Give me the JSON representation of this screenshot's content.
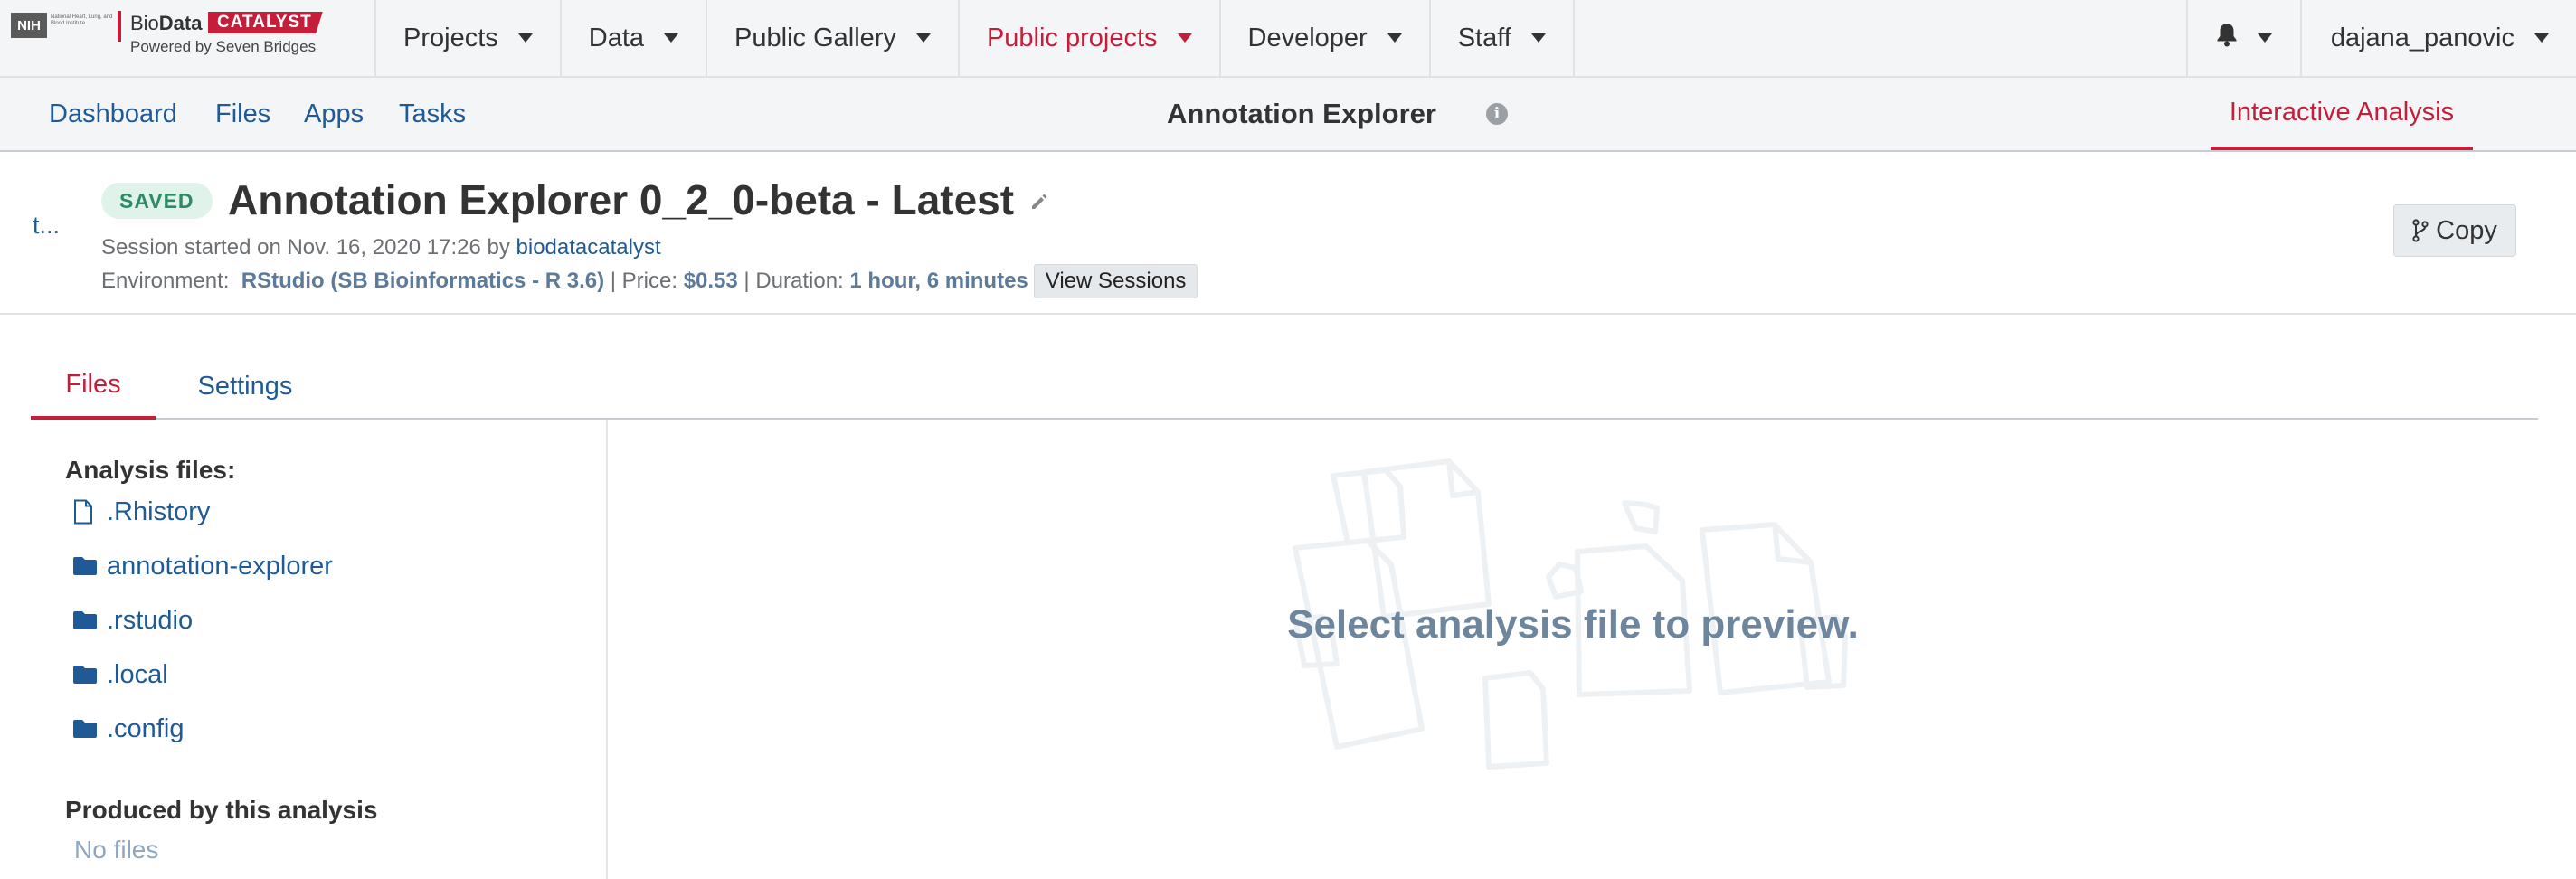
{
  "brand": {
    "nih": "NIH",
    "nih_text": "National Heart, Lung, and Blood Institute",
    "bio_prefix": "Bio",
    "bio_bold": "Data",
    "catalyst": "CATALYST",
    "powered": "Powered by Seven Bridges",
    "accent": "#c41e3a"
  },
  "topnav": {
    "items": [
      {
        "label": "Projects"
      },
      {
        "label": "Data"
      },
      {
        "label": "Public Gallery"
      },
      {
        "label": "Public projects"
      },
      {
        "label": "Developer"
      },
      {
        "label": "Staff"
      }
    ],
    "user": "dajana_panovic",
    "bell_icon": "bell-icon"
  },
  "subnav": {
    "links": [
      "Dashboard",
      "Files",
      "Apps",
      "Tasks"
    ],
    "title": "Annotation Explorer",
    "info_icon": "i",
    "active_tab": "Interactive Analysis"
  },
  "session": {
    "back": "t...",
    "status": "SAVED",
    "title": "Annotation Explorer 0_2_0-beta - Latest",
    "started_prefix": "Session started on Nov. 16, 2020 17:26 by ",
    "started_by": "biodatacatalyst",
    "env_label": "Environment:  ",
    "env_value": "RStudio (SB Bioinformatics - R 3.6)",
    "sep1": " | ",
    "price_label": "Price: ",
    "price_value": "$0.53",
    "sep2": " | ",
    "duration_label": "Duration: ",
    "duration_value": "1 hour, 6 minutes",
    "view_sessions": "View Sessions",
    "copy": "Copy"
  },
  "tabs": {
    "files": "Files",
    "settings": "Settings"
  },
  "files_panel": {
    "analysis_heading": "Analysis files:",
    "items": [
      {
        "name": ".Rhistory",
        "icon": "file-icon"
      },
      {
        "name": "annotation-explorer",
        "icon": "folder-icon"
      },
      {
        "name": ".rstudio",
        "icon": "folder-icon"
      },
      {
        "name": ".local",
        "icon": "folder-icon"
      },
      {
        "name": ".config",
        "icon": "folder-icon"
      }
    ],
    "produced_heading": "Produced by this analysis",
    "no_files": "No files"
  },
  "preview": {
    "message": "Select analysis file to preview."
  }
}
